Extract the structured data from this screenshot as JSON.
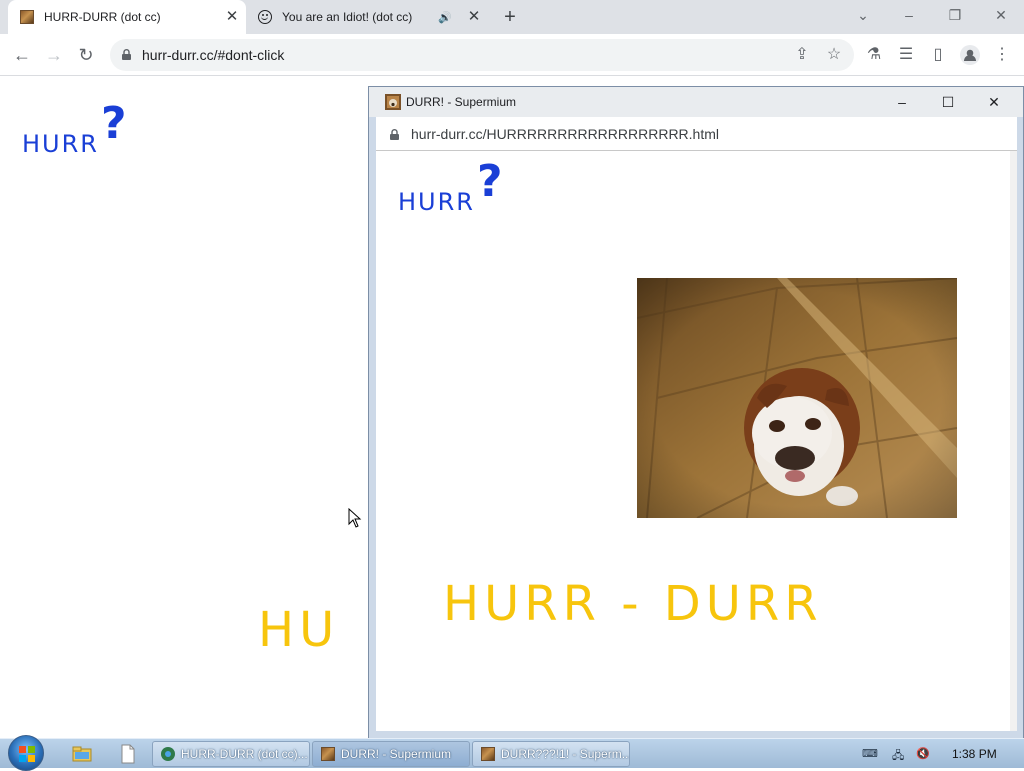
{
  "browser": {
    "tabs": [
      {
        "title": "HURR-DURR (dot cc)",
        "favicon": "dog-photo-favicon",
        "active": true
      },
      {
        "title": "You are an Idiot! (dot cc)",
        "favicon": "smiley-face-icon",
        "playing_audio": true,
        "active": false
      }
    ],
    "window_controls": [
      "chevron-down-icon",
      "minimize-icon",
      "restore-icon",
      "close-icon"
    ],
    "toolbar": {
      "back": "back-arrow-icon",
      "forward": "forward-arrow-icon",
      "reload": "reload-icon",
      "url": "hurr-durr.cc/#dont-click",
      "actions": [
        "share-icon",
        "star-icon",
        "labs-flask-icon",
        "reading-list-icon",
        "side-panel-icon",
        "profile-avatar-icon",
        "menu-dots-icon"
      ]
    }
  },
  "page": {
    "logo_text": "HURR",
    "logo_mark": "?",
    "big_text": "HU"
  },
  "popup": {
    "title": "DURR! - Supermium",
    "url": "hurr-durr.cc/HURRRRRRRRRRRRRRRRRR.html",
    "logo_text": "HURR",
    "logo_mark": "?",
    "big_text": "HURR - DURR",
    "image": "bulldog-photo"
  },
  "taskbar": {
    "tasks": [
      {
        "label": "HURR-DURR (dot cc)...",
        "icon": "supermium-icon",
        "active": false
      },
      {
        "label": "DURR! - Supermium",
        "icon": "dog-photo-favicon",
        "active": true
      },
      {
        "label": "DURR???!1! - Superm...",
        "icon": "dog-photo-favicon",
        "active": false
      }
    ],
    "time": "1:38 PM"
  },
  "colors": {
    "logo_blue": "#1a3fd6",
    "big_text_yellow": "#f7c50d",
    "tabbar_bg": "#dee1e6",
    "taskbar_bg": "#a9c3de"
  }
}
